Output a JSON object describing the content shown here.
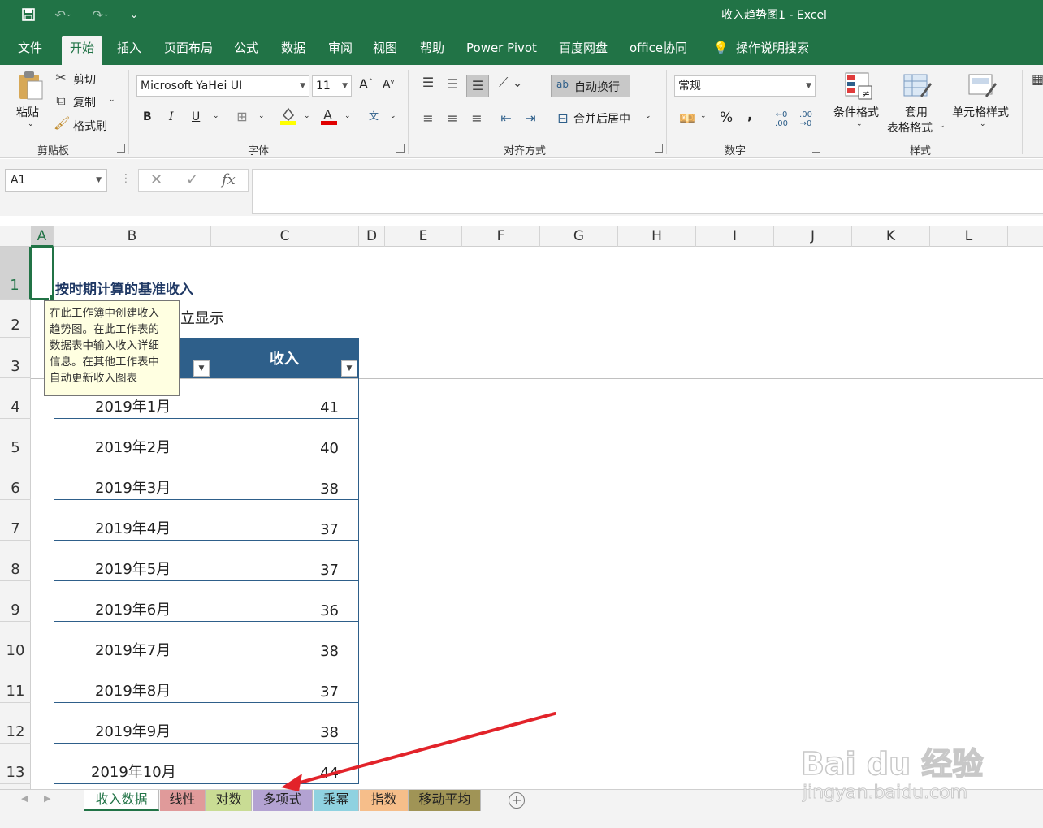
{
  "window": {
    "title": "收入趋势图1  -  Excel"
  },
  "quick_access": {
    "save_icon": "save-icon",
    "undo_icon": "undo-icon",
    "redo_icon": "redo-icon",
    "more_icon": "customize-icon"
  },
  "ribbon_tabs": [
    {
      "label": "文件"
    },
    {
      "label": "开始"
    },
    {
      "label": "插入"
    },
    {
      "label": "页面布局"
    },
    {
      "label": "公式"
    },
    {
      "label": "数据"
    },
    {
      "label": "审阅"
    },
    {
      "label": "视图"
    },
    {
      "label": "帮助"
    },
    {
      "label": "Power Pivot"
    },
    {
      "label": "百度网盘"
    },
    {
      "label": "office协同"
    },
    {
      "label": "操作说明搜索"
    }
  ],
  "ribbon": {
    "clipboard": {
      "paste": "粘贴",
      "cut": "剪切",
      "copy": "复制",
      "format_painter": "格式刷",
      "group": "剪贴板"
    },
    "font": {
      "name": "Microsoft YaHei UI",
      "size": "11",
      "bold": "B",
      "italic": "I",
      "underline": "U",
      "group": "字体"
    },
    "alignment": {
      "wrap": "自动换行",
      "merge": "合并后居中",
      "group": "对齐方式"
    },
    "number": {
      "format": "常规",
      "percent": "%",
      "comma": ",",
      "group": "数字"
    },
    "styles": {
      "conditional": "条件格式",
      "table1": "套用",
      "table2": "表格格式",
      "cell": "单元格样式",
      "group": "样式"
    }
  },
  "formula_bar": {
    "name_box": "A1",
    "cancel": "✕",
    "enter": "✓",
    "fx": "fx"
  },
  "columns": [
    "A",
    "B",
    "C",
    "D",
    "E",
    "F",
    "G",
    "H",
    "I",
    "J",
    "K",
    "L"
  ],
  "rows": [
    "1",
    "2",
    "3",
    "4",
    "5",
    "6",
    "7",
    "8",
    "9",
    "10",
    "11",
    "12",
    "13"
  ],
  "sheet": {
    "title": "按时期计算的基准收入",
    "subtitle_partial": "立显示",
    "header_value": "收入",
    "tooltip": [
      "在此工作簿中创建收入",
      "趋势图。在此工作表的",
      "数据表中输入收入详细",
      "信息。在其他工作表中",
      "自动更新收入图表"
    ],
    "data": [
      {
        "period": "2019年1月",
        "value": "41"
      },
      {
        "period": "2019年2月",
        "value": "40"
      },
      {
        "period": "2019年3月",
        "value": "38"
      },
      {
        "period": "2019年4月",
        "value": "37"
      },
      {
        "period": "2019年5月",
        "value": "37"
      },
      {
        "period": "2019年6月",
        "value": "36"
      },
      {
        "period": "2019年7月",
        "value": "38"
      },
      {
        "period": "2019年8月",
        "value": "37"
      },
      {
        "period": "2019年9月",
        "value": "38"
      },
      {
        "period": "2019年10月",
        "value": "44"
      }
    ]
  },
  "sheet_tabs": [
    {
      "label": "收入数据",
      "color": "#ffffff"
    },
    {
      "label": "线性",
      "color": "#e09a9a"
    },
    {
      "label": "对数",
      "color": "#c9dc94"
    },
    {
      "label": "多项式",
      "color": "#b3a2d2"
    },
    {
      "label": "乘幂",
      "color": "#8fd2e0"
    },
    {
      "label": "指数",
      "color": "#f6be8a"
    },
    {
      "label": "移动平均",
      "color": "#a09456"
    }
  ],
  "watermark": {
    "brand": "Bai du 经验",
    "url": "jingyan.baidu.com"
  },
  "colors": {
    "excel_green": "#217346",
    "table_header": "#2e5f8a",
    "annotation_arrow": "#e2232a"
  }
}
